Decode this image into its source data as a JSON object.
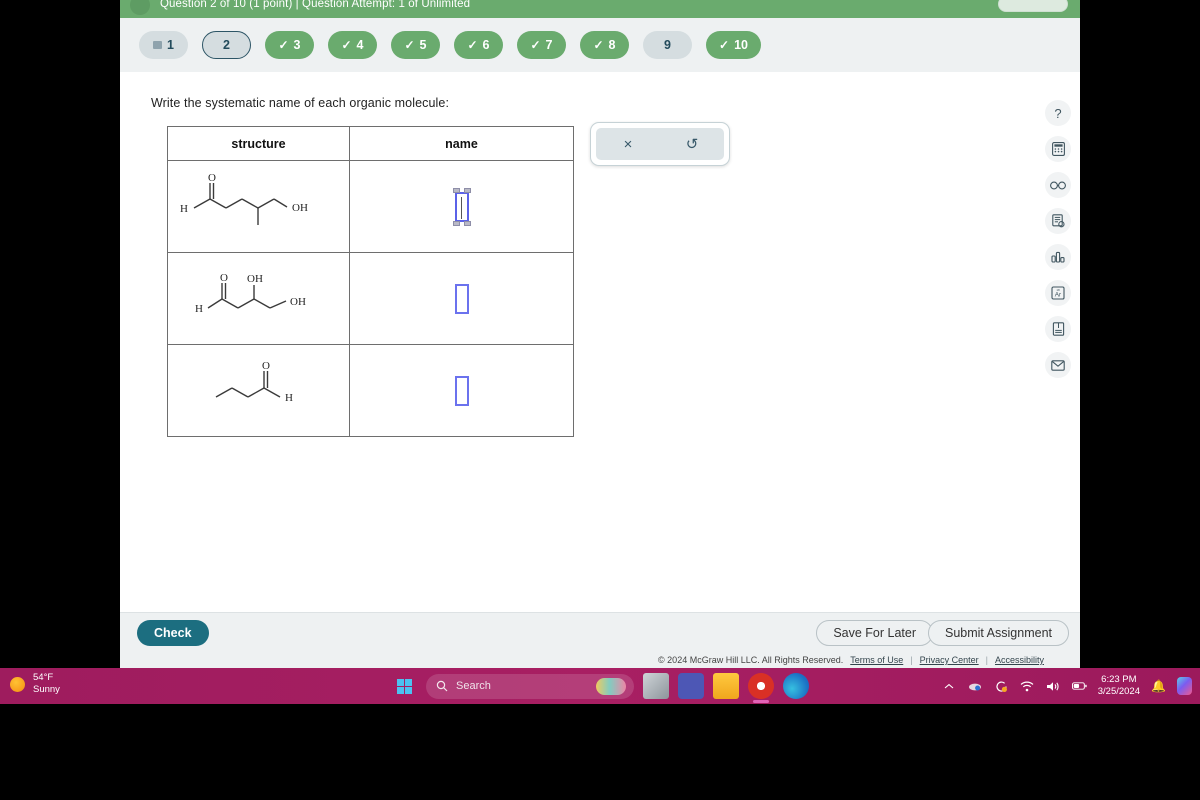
{
  "header": {
    "title": "Question 2 of 10 (1 point) | Question Attempt: 1 of Unlimited",
    "avatar_icon": "avatar-icon",
    "action_button_label": ""
  },
  "question_nav": {
    "items": [
      {
        "label": "1",
        "state": "flagged",
        "icon": "flag-icon",
        "check": ""
      },
      {
        "label": "2",
        "state": "current",
        "icon": "",
        "check": ""
      },
      {
        "label": "3",
        "state": "done",
        "icon": "check-icon",
        "check": "✓"
      },
      {
        "label": "4",
        "state": "done",
        "icon": "check-icon",
        "check": "✓"
      },
      {
        "label": "5",
        "state": "done",
        "icon": "check-icon",
        "check": "✓"
      },
      {
        "label": "6",
        "state": "done",
        "icon": "check-icon",
        "check": "✓"
      },
      {
        "label": "7",
        "state": "done",
        "icon": "check-icon",
        "check": "✓"
      },
      {
        "label": "8",
        "state": "done",
        "icon": "check-icon",
        "check": "✓"
      },
      {
        "label": "9",
        "state": "todo",
        "icon": "",
        "check": ""
      },
      {
        "label": "10",
        "state": "done",
        "icon": "check-icon",
        "check": "✓"
      }
    ]
  },
  "question": {
    "prompt": "Write the systematic name of each organic molecule:",
    "table": {
      "columns": [
        "structure",
        "name"
      ],
      "rows": [
        {
          "structure_name": "molecule-4-methyl-5-hydroxypentanal",
          "structure_labels": {
            "carbonyl_o": "O",
            "aldehyde_h": "H",
            "hydroxyl": "OH"
          },
          "answer_value": "",
          "answer_state": "focused"
        },
        {
          "structure_name": "molecule-3-4-dihydroxybutanal",
          "structure_labels": {
            "carbonyl_o": "O",
            "aldehyde_h": "H",
            "hydroxyl_mid": "OH",
            "hydroxyl_end": "OH"
          },
          "answer_value": "",
          "answer_state": "empty"
        },
        {
          "structure_name": "molecule-butanal",
          "structure_labels": {
            "carbonyl_o": "O",
            "aldehyde_h": "H"
          },
          "answer_value": "",
          "answer_state": "empty"
        }
      ]
    }
  },
  "answer_toolbar": {
    "buttons": [
      {
        "name": "clear-answer-button",
        "glyph": "×"
      },
      {
        "name": "undo-button",
        "glyph": "↺"
      }
    ]
  },
  "tool_rail": {
    "items": [
      {
        "name": "help-icon",
        "glyph": "?"
      },
      {
        "name": "calculator-icon",
        "glyph": ""
      },
      {
        "name": "glasses-icon",
        "glyph": ""
      },
      {
        "name": "reference-sheet-icon",
        "glyph": ""
      },
      {
        "name": "bar-chart-icon",
        "glyph": ""
      },
      {
        "name": "periodic-table-icon",
        "glyph": "Ar"
      },
      {
        "name": "textbook-icon",
        "glyph": ""
      },
      {
        "name": "message-icon",
        "glyph": ""
      }
    ]
  },
  "actions": {
    "check_label": "Check",
    "save_label": "Save For Later",
    "submit_label": "Submit Assignment"
  },
  "footer": {
    "copyright": "© 2024 McGraw Hill LLC. All Rights Reserved.",
    "links": [
      "Terms of Use",
      "Privacy Center",
      "Accessibility"
    ],
    "separator": "|"
  },
  "taskbar": {
    "weather": {
      "temperature": "54°F",
      "condition": "Sunny",
      "icon": "sun-icon"
    },
    "search_placeholder": "Search",
    "apps": [
      {
        "name": "start-button",
        "label": "Start"
      },
      {
        "name": "task-view-button",
        "label": "Task View"
      },
      {
        "name": "teams-app",
        "label": "T"
      },
      {
        "name": "file-explorer-app",
        "label": "File Explorer"
      },
      {
        "name": "chrome-app",
        "label": "Google Chrome"
      },
      {
        "name": "edge-app",
        "label": "Microsoft Edge"
      }
    ],
    "clock": {
      "time": "6:23 PM",
      "date": "3/25/2024"
    },
    "tray_icons": [
      "chevron-up-icon",
      "onedrive-icon",
      "update-icon",
      "wifi-icon",
      "volume-icon",
      "battery-icon",
      "bell-icon",
      "copilot-icon"
    ]
  },
  "colors": {
    "header_green": "#6aab6e",
    "pill_done": "#6aab6e",
    "pill_todo": "#d5dde0",
    "check_button": "#1c6e80",
    "answer_border": "#6b72ee",
    "taskbar": "#a31b5f"
  }
}
